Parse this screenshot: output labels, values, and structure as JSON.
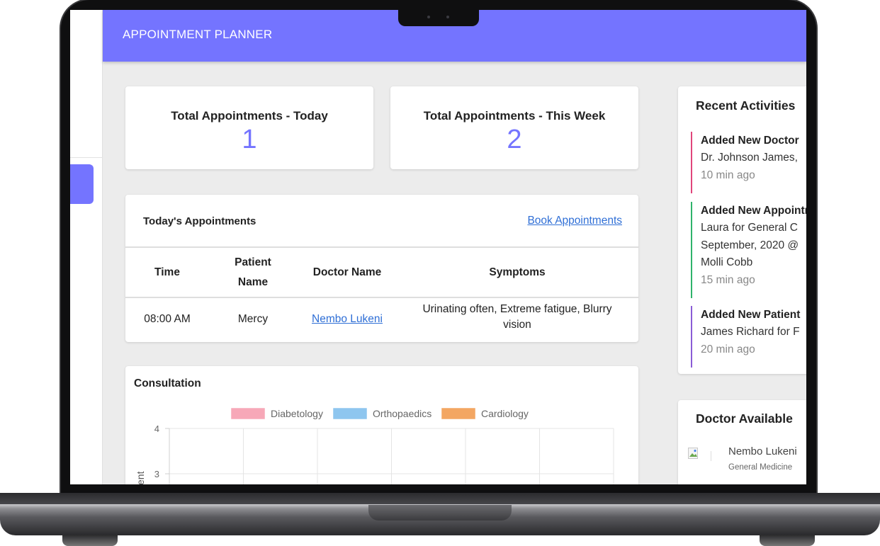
{
  "header": {
    "title": "APPOINTMENT PLANNER"
  },
  "stats": {
    "today_title": "Total Appointments - Today",
    "today_value": "1",
    "week_title": "Total Appointments - This Week",
    "week_value": "2"
  },
  "appointments": {
    "title": "Today's Appointments",
    "book_link": "Book Appointments",
    "columns": {
      "time": "Time",
      "patient_1": "Patient",
      "patient_2": "Name",
      "doctor": "Doctor Name",
      "symptoms": "Symptoms"
    },
    "rows": [
      {
        "time": "08:00 AM",
        "patient": "Mercy",
        "doctor": "Nembo Lukeni",
        "symptoms_1": "Urinating often, Extreme fatigue, Blurry",
        "symptoms_2": "vision"
      }
    ]
  },
  "consultation": {
    "title": "Consultation",
    "y_axis_fragment": "ent"
  },
  "chart_data": {
    "type": "bar",
    "series": [
      {
        "name": "Diabetology",
        "values": []
      },
      {
        "name": "Orthopaedics",
        "values": []
      },
      {
        "name": "Cardiology",
        "values": []
      }
    ],
    "series_colors": [
      "#f7a8b8",
      "#8ec6ef",
      "#f3a662"
    ],
    "legend_placement": "top",
    "y_ticks": [
      "4",
      "3"
    ],
    "grid": true
  },
  "recent_activities": {
    "title": "Recent Activities",
    "items": [
      {
        "head": "Added New Doctor",
        "lines": [
          "Dr. Johnson James,"
        ],
        "time": "10 min ago",
        "color": "#e0457b"
      },
      {
        "head": "Added New Appointment",
        "lines": [
          "Laura for General C",
          "September, 2020 @",
          "Molli Cobb"
        ],
        "time": "15 min ago",
        "color": "#2fb36b"
      },
      {
        "head": "Added New Patient",
        "lines": [
          "James Richard for F"
        ],
        "time": "20 min ago",
        "color": "#8a5cd6"
      }
    ]
  },
  "doctor_available": {
    "title": "Doctor Available",
    "doctors": [
      {
        "name": "Nembo Lukeni",
        "specialty": "General Medicine"
      }
    ]
  }
}
